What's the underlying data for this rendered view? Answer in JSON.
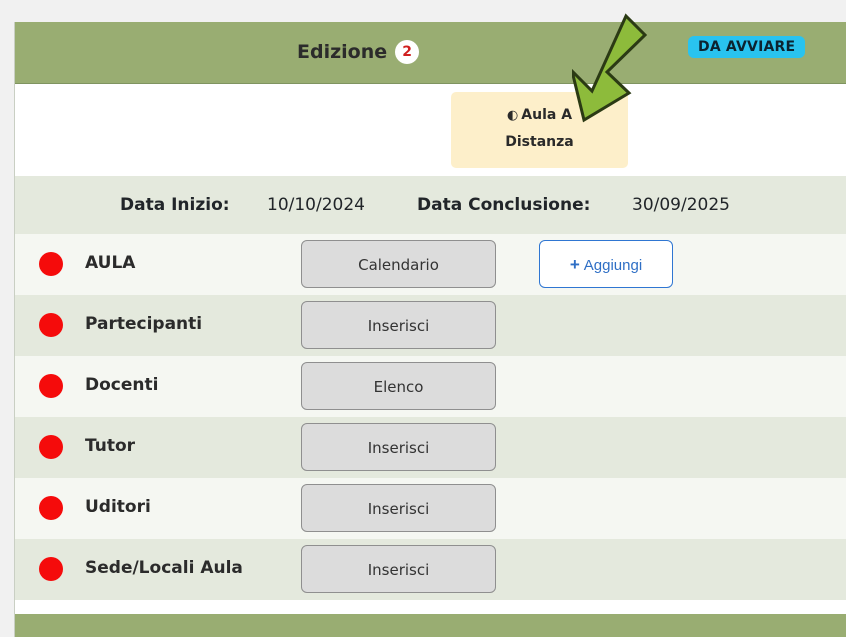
{
  "header": {
    "title": "Edizione",
    "count": "2",
    "status": "DA AVVIARE"
  },
  "mode": {
    "line1": "Aula A",
    "line2": "Distanza"
  },
  "dates": {
    "start_label": "Data Inizio:",
    "start_value": "10/10/2024",
    "end_label": "Data Conclusione:",
    "end_value": "30/09/2025"
  },
  "rows": [
    {
      "label": "AULA",
      "button": "Calendario",
      "extra": "Aggiungi"
    },
    {
      "label": "Partecipanti",
      "button": "Inserisci"
    },
    {
      "label": "Docenti",
      "button": "Elenco"
    },
    {
      "label": "Tutor",
      "button": "Inserisci"
    },
    {
      "label": "Uditori",
      "button": "Inserisci"
    },
    {
      "label": "Sede/Locali Aula",
      "button": "Inserisci"
    }
  ],
  "colors": {
    "header": "#99ad72",
    "status_badge": "#29c3ef",
    "status_dot": "#f50b0b",
    "arrow": "#8dbb3b",
    "mode_box": "#fdefca",
    "accent_blue": "#2f76d2"
  },
  "icons": {
    "mode": "toggle-icon",
    "add": "plus-icon",
    "annotation": "arrow-icon"
  }
}
